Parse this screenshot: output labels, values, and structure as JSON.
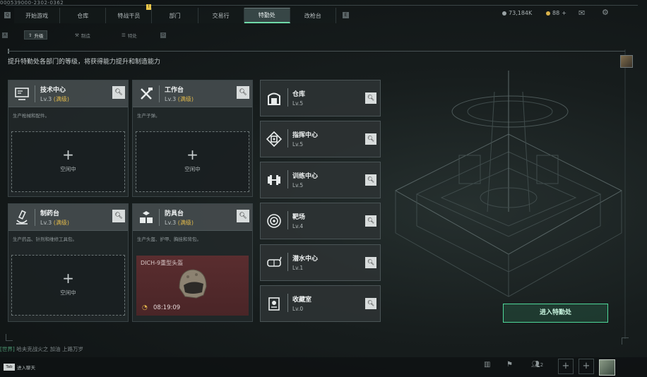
{
  "version": "000539000-2302-0362",
  "nav": {
    "tabs": [
      "开始游戏",
      "仓库",
      "特战干员",
      "部门",
      "交易行",
      "特勤处",
      "改枪台"
    ],
    "active": "特勤处",
    "badge": "!",
    "left_key": "Q",
    "right_key": "E"
  },
  "currency": {
    "silver_value": "73,184K",
    "gold_value": "88",
    "gold_plus": "+",
    "silver_color": "#9aa3a5",
    "gold_color": "#d9b24a"
  },
  "top_icons": [
    "mail-icon",
    "gear-icon"
  ],
  "subtabs": {
    "items": [
      "升级",
      "制造",
      "特处"
    ],
    "active": "升级",
    "left_key": "A",
    "right_key": "D"
  },
  "description": "提升特勤处各部门的等级，将获得能力提升和制造能力",
  "facilities": [
    {
      "name": "技术中心",
      "level": "Lv.3",
      "max": "(满级)",
      "desc": "生产枪械和配件。",
      "slot": "空闲中",
      "icon": "computer-icon"
    },
    {
      "name": "工作台",
      "level": "Lv.3",
      "max": "(满级)",
      "desc": "生产子弹。",
      "slot": "空闲中",
      "icon": "tools-icon"
    },
    {
      "name": "制药台",
      "level": "Lv.3",
      "max": "(满级)",
      "desc": "生产药品、针剂和维修工具包。",
      "slot": "空闲中",
      "icon": "microscope-icon"
    },
    {
      "name": "防具台",
      "level": "Lv.3",
      "max": "(满级)",
      "desc": "生产头盔、护甲、胸挂和背包。",
      "icon": "armor-icon",
      "production": {
        "item": "DICH-9重型头盔",
        "timer": "08:19:09"
      }
    }
  ],
  "side_facilities": [
    {
      "name": "仓库",
      "level": "Lv.5",
      "icon": "storage-icon"
    },
    {
      "name": "指挥中心",
      "level": "Lv.5",
      "icon": "command-icon"
    },
    {
      "name": "训练中心",
      "level": "Lv.5",
      "icon": "dumbbell-icon"
    },
    {
      "name": "靶场",
      "level": "Lv.4",
      "icon": "target-icon"
    },
    {
      "name": "潜水中心",
      "level": "Lv.1",
      "icon": "diving-mask-icon"
    },
    {
      "name": "收藏室",
      "level": "Lv.0",
      "icon": "collection-icon"
    }
  ],
  "enter_button": "进入特勤处",
  "chat": {
    "system_tag": "[世界]",
    "message": "哈夫克战火之 加油 上路万岁"
  },
  "bottom": {
    "tab_key": "Tab",
    "chat_placeholder": "进入聊天",
    "friends_count": "2",
    "plus": "+"
  }
}
